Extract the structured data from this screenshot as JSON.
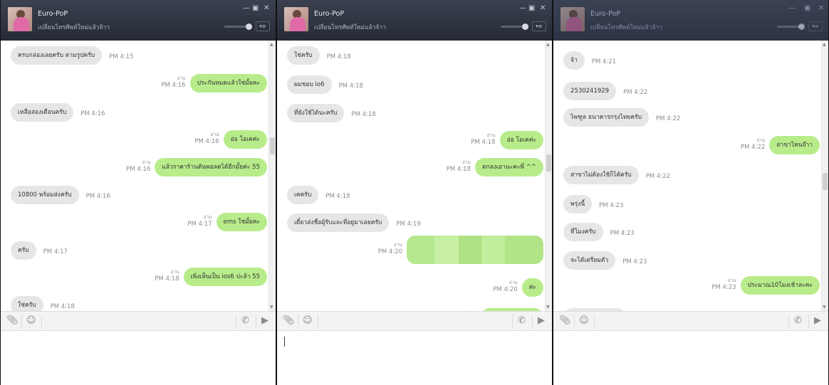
{
  "windows": [
    {
      "title": "Euro-PoP",
      "status": "เปลี่ยนโทรศัพท์ใหม่แล้วจ้าา",
      "controls": {
        "min": "—",
        "max": "▣",
        "close": "✕",
        "menu": "▾≡"
      },
      "messages": [
        {
          "dir": "in",
          "text": "ครบกล่องเลยครับ ตามรูปครับ",
          "time": "PM 4:15"
        },
        {
          "dir": "out",
          "text": "ประกันหมดแล้วใช่มั้ยคะ",
          "time": "PM 4:16",
          "read": "อ่าน"
        },
        {
          "dir": "in",
          "text": "เหลือสองเดือนครับ",
          "time": "PM 4:16"
        },
        {
          "dir": "out",
          "text": "อ่อ โอเคค่ะ",
          "time": "PM 4:16",
          "read": "อ่าน"
        },
        {
          "dir": "out",
          "text": "แล้วราคาร้านต้นพอลดได้อีกมั้ยค่ะ 55",
          "time": "PM 4:16",
          "read": "อ่าน"
        },
        {
          "dir": "in",
          "text": "10800 พร้อมส่งครับ",
          "time": "PM 4:16"
        },
        {
          "dir": "out",
          "text": "ems ใช่มั้ยคะ",
          "time": "PM 4:17",
          "read": "อ่าน"
        },
        {
          "dir": "in",
          "text": "ครับ",
          "time": "PM 4:17"
        },
        {
          "dir": "out",
          "text": "เพิ่งเห็นเป็น ios6 ปะล้า 55",
          "time": "PM 4:18",
          "read": "อ่าน"
        },
        {
          "dir": "in",
          "text": "ใช่ครับ",
          "time": "PM 4:18"
        }
      ]
    },
    {
      "title": "Euro-PoP",
      "status": "เปลี่ยนโทรศัพท์ใหม่แล้วจ้าา",
      "controls": {
        "min": "—",
        "max": "▣",
        "close": "✕",
        "menu": "▾≡"
      },
      "messages": [
        {
          "dir": "in",
          "text": "ใช่ครับ",
          "time": "PM 4:18"
        },
        {
          "dir": "in",
          "text": "ผมชอบ io6",
          "time": "PM 4:18"
        },
        {
          "dir": "in",
          "text": "ที่ยังใช้ได้นะครับ",
          "time": "PM 4:18"
        },
        {
          "dir": "out",
          "text": "อ่อ โอเคค่ะ",
          "time": "PM 4:18",
          "read": "อ่าน"
        },
        {
          "dir": "out",
          "text": "ตกลงเอานะคะพี่ ^^",
          "time": "PM 4:18",
          "read": "อ่าน"
        },
        {
          "dir": "in",
          "text": "เคครับ",
          "time": "PM 4:18"
        },
        {
          "dir": "in",
          "text": "เดี๋ยวส่งชื่อผู้รับและที่อยู่มาเลยครับ",
          "time": "PM 4:19"
        },
        {
          "dir": "out",
          "text": "",
          "time": "PM 4:20",
          "read": "อ่าน",
          "blurred": true
        },
        {
          "dir": "out",
          "text": "ค่ะ",
          "time": "PM 4:20",
          "read": "อ่าน"
        },
        {
          "dir": "out",
          "text": "",
          "time": "",
          "read": "อ่าน",
          "partial": true
        }
      ]
    },
    {
      "title": "Euro-PoP",
      "status": "เปลี่ยนโทรศัพท์ใหม่แล้วจ้าา",
      "controls": {
        "min": "—",
        "max": "▣",
        "close": "✕",
        "menu": "▾≡"
      },
      "messages": [
        {
          "dir": "in",
          "text": "จ้า",
          "time": "PM 4:21"
        },
        {
          "dir": "in",
          "text": "2530241929",
          "time": "PM 4:22"
        },
        {
          "dir": "in",
          "text": "ไพฑูล ธนาคารกรุงไทยครับ",
          "time": "PM 4:22"
        },
        {
          "dir": "out",
          "text": "สาขาไหนจ๊าา",
          "time": "PM 4:22",
          "read": "อ่าน"
        },
        {
          "dir": "in",
          "text": "สาขาไม่ต้องใช้ก็ได้ครับ",
          "time": "PM 4:22"
        },
        {
          "dir": "in",
          "text": "พรุ่งนี้",
          "time": "PM 4:23"
        },
        {
          "dir": "in",
          "text": "ที่โมงครับ",
          "time": "PM 4:23"
        },
        {
          "dir": "in",
          "text": "จะได้เตรียมตัว",
          "time": "PM 4:23"
        },
        {
          "dir": "out",
          "text": "ประมาณ10โมงเช้าละคะ",
          "time": "PM 4:23",
          "read": "อ่าน"
        },
        {
          "dir": "in",
          "text": "",
          "time": "",
          "partial": true
        }
      ]
    }
  ],
  "toolbar_icons": [
    "paperclip-icon",
    "emoji-icon",
    "phone-icon",
    "video-icon"
  ],
  "colors": {
    "titlebar": "#2b303b",
    "outgoing_bubble": "#b8ec8b",
    "incoming_bubble": "#e6e6e6"
  }
}
